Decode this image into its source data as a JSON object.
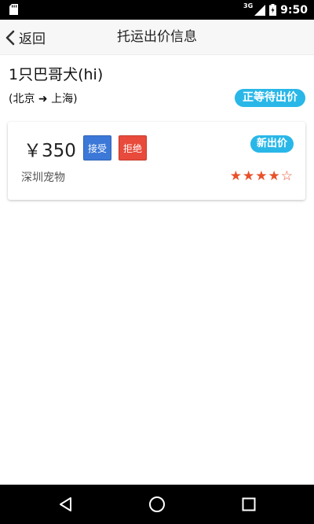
{
  "status_bar": {
    "network": "3G",
    "time": "9:50"
  },
  "header": {
    "back_label": "返回",
    "title": "托运出价信息"
  },
  "order": {
    "pet_title": "1只巴哥犬(hi)",
    "route": "(北京 ➜ 上海)",
    "status": "正等待出价"
  },
  "bid": {
    "price": "￥350",
    "accept_label": "接受",
    "reject_label": "拒绝",
    "badge": "新出价",
    "company": "深圳宠物",
    "rating_stars": "★★★★☆",
    "rating_value": 4,
    "rating_max": 5
  },
  "colors": {
    "accent": "#29b7e8",
    "accept": "#3c78d8",
    "reject": "#e84a3b",
    "star": "#e8502b"
  },
  "icons": {
    "back": "chevron-left-icon",
    "nav_back": "triangle-back-icon",
    "nav_home": "circle-home-icon",
    "nav_recent": "square-recents-icon"
  }
}
